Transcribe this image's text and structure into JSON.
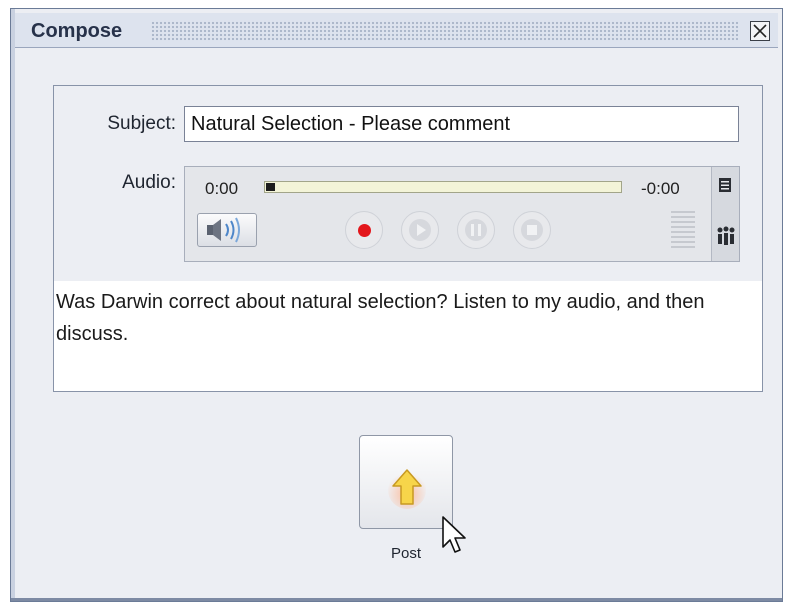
{
  "window": {
    "title": "Compose",
    "close_glyph": "✕",
    "colors": {
      "frame": "#6b7b97",
      "titlebar": "#dde3ee",
      "background": "#eceef3"
    }
  },
  "form": {
    "subject_label": "Subject:",
    "subject_value": "Natural Selection - Please comment",
    "audio_label": "Audio:"
  },
  "audio": {
    "time_elapsed": "0:00",
    "time_remaining": "-0:00",
    "progress": 0,
    "controls": [
      "volume-icon",
      "record-icon",
      "play-icon",
      "pause-icon",
      "stop-icon"
    ],
    "record_color": "#e3161b"
  },
  "body": {
    "text": "Was Darwin correct about natural selection?  Listen to my audio, and then discuss."
  },
  "actions": {
    "post_label": "Post",
    "post_icon": "up-arrow-icon",
    "post_icon_color": "#f7d54a"
  }
}
